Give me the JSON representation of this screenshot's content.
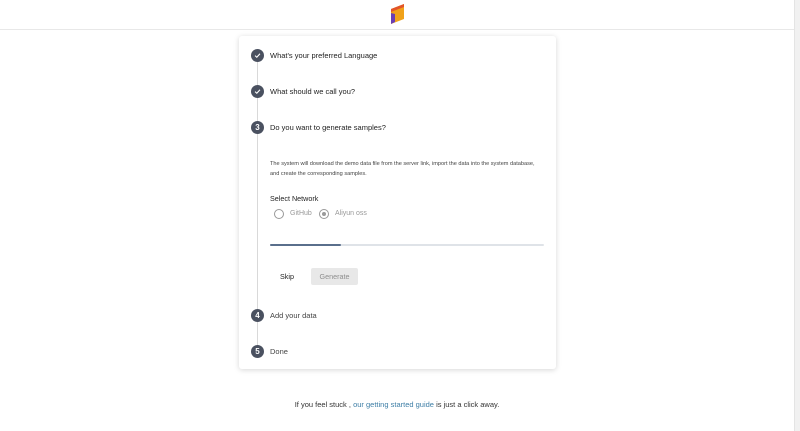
{
  "header": {
    "logo_icon": "bookmark-logo-icon"
  },
  "steps": [
    {
      "number": "1",
      "title": "What's your preferred Language",
      "state": "done"
    },
    {
      "number": "2",
      "title": "What should we call you?",
      "state": "done"
    },
    {
      "number": "3",
      "title": "Do you want to generate samples?",
      "state": "active"
    },
    {
      "number": "4",
      "title": "Add your data",
      "state": "pending"
    },
    {
      "number": "5",
      "title": "Done",
      "state": "pending"
    }
  ],
  "samples": {
    "description": "The system will download the demo data file from the server link, import the data into the system database, and create the corresponding samples.",
    "network_label": "Select Network",
    "options": [
      "GitHub",
      "Aliyun oss"
    ],
    "selected": "Aliyun oss",
    "progress": 0.26,
    "skip_label": "Skip",
    "generate_label": "Generate"
  },
  "footer": {
    "prefix": "If you feel stuck ,",
    "link_text": "our getting started guide",
    "suffix": "is just a click away."
  },
  "colors": {
    "badge": "#4a5160",
    "link": "#3d7ea6",
    "logo_orange": "#f0a21a",
    "logo_purple": "#6a3fb5",
    "progress_fill": "#5a6f8c"
  }
}
